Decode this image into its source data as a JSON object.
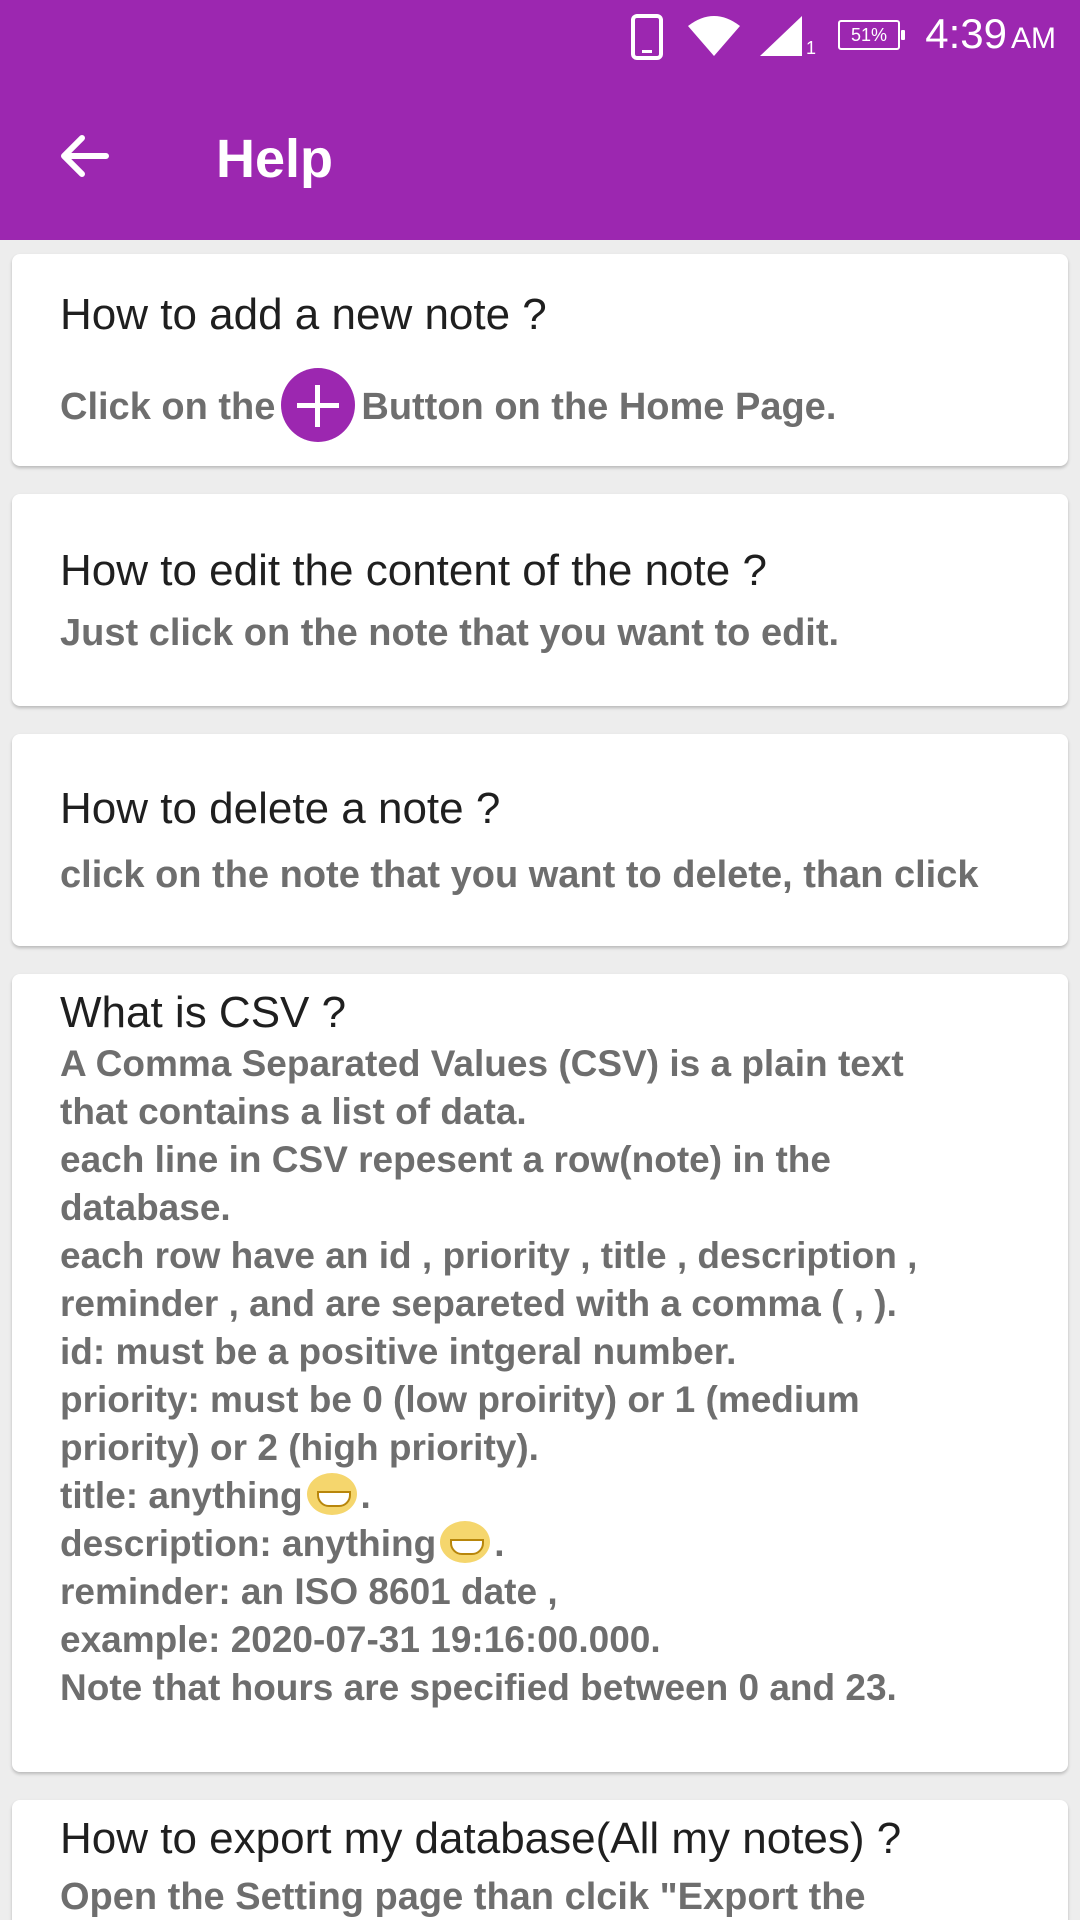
{
  "status_bar": {
    "battery_percent": "51%",
    "time": "4:39",
    "ampm": "AM",
    "sim_number": "1"
  },
  "toolbar": {
    "title": "Help"
  },
  "faq": {
    "add_note": {
      "question": "How to add a new note ?",
      "answer_before": "Click on the",
      "answer_after": "Button on the Home Page."
    },
    "edit_note": {
      "question": "How to edit the content of the note ?",
      "answer": "Just click on the note that you want to edit."
    },
    "delete_note": {
      "question": "How to delete a note ?",
      "answer": "click on the note that you want to delete, than click"
    },
    "csv": {
      "question": "What is CSV ?",
      "lines": [
        "A Comma Separated Values (CSV) is a plain text",
        "that contains a list of data.",
        "each line in CSV repesent a row(note) in the",
        "database.",
        "each row have an id , priority , title , description ,",
        "reminder , and are separeted with a comma ( , ).",
        "id: must be a positive intgeral number.",
        "priority: must be 0 (low proirity) or 1 (medium",
        "priority) or 2 (high priority).",
        "title: anything",
        "description: anything",
        "reminder: an ISO 8601 date ,",
        "example: 2020-07-31 19:16:00.000.",
        "Note that hours are specified between 0 and 23."
      ],
      "period": "."
    },
    "export": {
      "question": "How to export my database(All my notes) ?",
      "answer": "Open the Setting page than clcik \"Export the"
    }
  }
}
